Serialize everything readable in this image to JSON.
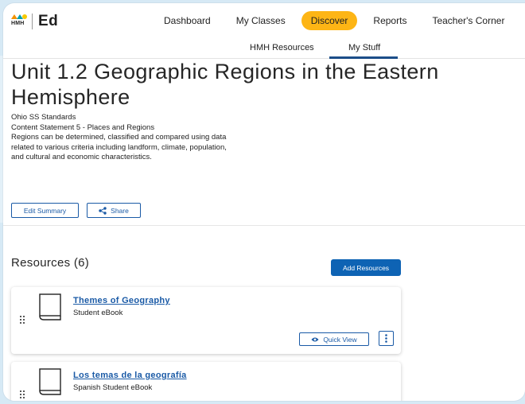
{
  "logo": {
    "brand_mark": "HMH",
    "app_name": "Ed"
  },
  "nav": {
    "items": [
      {
        "label": "Dashboard"
      },
      {
        "label": "My Classes"
      },
      {
        "label": "Discover"
      },
      {
        "label": "Reports"
      },
      {
        "label": "Teacher's Corner"
      }
    ],
    "active_index": 2
  },
  "subnav": {
    "items": [
      {
        "label": "HMH Resources"
      },
      {
        "label": "My Stuff"
      }
    ],
    "active_index": 1
  },
  "unit": {
    "title": "Unit 1.2 Geographic Regions in the Eastern Hemisphere",
    "description_lines": [
      "Ohio SS Standards",
      "Content Statement 5 - Places and Regions",
      "Regions can be determined, classified and compared using data",
      "related to various criteria including landform, climate, population,",
      "and cultural and economic characteristics."
    ]
  },
  "actions": {
    "edit_summary": "Edit Summary",
    "share": "Share"
  },
  "resources": {
    "heading": "Resources (6)",
    "add_button": "Add Resources",
    "quick_view_label": "Quick View",
    "items": [
      {
        "title": "Themes of Geography",
        "type": "Student eBook"
      },
      {
        "title": "Los temas de la geografía",
        "type": "Spanish Student eBook"
      }
    ]
  },
  "colors": {
    "accent": "#fdb515",
    "link": "#1a5aa6",
    "primary_button": "#0e63b4",
    "subnav_underline": "#1c4e89"
  },
  "icons": [
    "hmh-logo",
    "share-icon",
    "book-icon",
    "drag-handle-icon",
    "eye-icon",
    "kebab-menu-icon"
  ]
}
